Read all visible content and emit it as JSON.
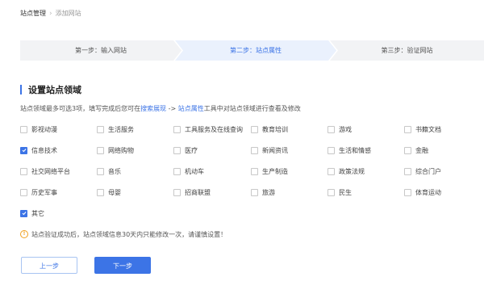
{
  "breadcrumb": {
    "home": "站点管理",
    "current": "添加网站"
  },
  "steps": [
    {
      "label": "第一步：输入网站",
      "active": false
    },
    {
      "label": "第二步：站点属性",
      "active": true
    },
    {
      "label": "第三步：验证网站",
      "active": false
    }
  ],
  "section": {
    "title": "设置站点领域",
    "desc_prefix": "站点领域最多可选3项，填写完成后您可在",
    "desc_link1": "搜索展现",
    "desc_arrow": " -> ",
    "desc_link2": "站点属性",
    "desc_suffix": "工具中对站点领域进行查看及修改"
  },
  "categories": [
    {
      "label": "影视动漫",
      "checked": false
    },
    {
      "label": "生活服务",
      "checked": false
    },
    {
      "label": "工具服务及在线查询",
      "checked": false
    },
    {
      "label": "教育培训",
      "checked": false
    },
    {
      "label": "游戏",
      "checked": false
    },
    {
      "label": "书籍文档",
      "checked": false
    },
    {
      "label": "信息技术",
      "checked": true
    },
    {
      "label": "网络购物",
      "checked": false
    },
    {
      "label": "医疗",
      "checked": false
    },
    {
      "label": "新闻资讯",
      "checked": false
    },
    {
      "label": "生活和情感",
      "checked": false
    },
    {
      "label": "金融",
      "checked": false
    },
    {
      "label": "社交网络平台",
      "checked": false
    },
    {
      "label": "音乐",
      "checked": false
    },
    {
      "label": "机动车",
      "checked": false
    },
    {
      "label": "生产制造",
      "checked": false
    },
    {
      "label": "政策法规",
      "checked": false
    },
    {
      "label": "综合门户",
      "checked": false
    },
    {
      "label": "历史军事",
      "checked": false
    },
    {
      "label": "母婴",
      "checked": false
    },
    {
      "label": "招商联盟",
      "checked": false
    },
    {
      "label": "旅游",
      "checked": false
    },
    {
      "label": "民生",
      "checked": false
    },
    {
      "label": "体育运动",
      "checked": false
    },
    {
      "label": "其它",
      "checked": true
    }
  ],
  "notice": "站点验证成功后，站点领域信息30天内只能修改一次，请谨慎设置！",
  "buttons": {
    "prev": "上一步",
    "next": "下一步"
  },
  "colors": {
    "accent": "#3c74e6",
    "warning": "#f0a020"
  }
}
